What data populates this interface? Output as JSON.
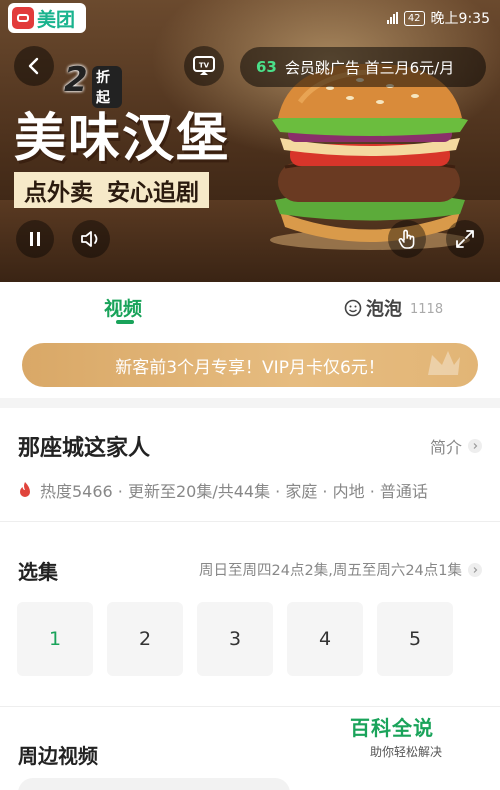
{
  "status_bar": {
    "time": "晚上9:35",
    "battery": "42"
  },
  "app_badge": {
    "name": "美团"
  },
  "ad": {
    "skip_count": "63",
    "skip_text": "会员跳广告 首三月6元/月",
    "promo_number": "2",
    "promo_text": "折起",
    "headline": "美味汉堡",
    "sub_left": "点外卖",
    "sub_right": "安心追剧"
  },
  "tabs": {
    "video": "视频",
    "bubbles": "泡泡",
    "bubbles_count": "1118"
  },
  "vip_banner": {
    "text": "新客前3个月专享！VIP月卡仅6元！"
  },
  "show": {
    "title": "那座城这家人",
    "intro_link": "简介",
    "meta": "热度5466 · 更新至20集/共44集 · 家庭 · 内地 · 普通话"
  },
  "episodes": {
    "title": "选集",
    "schedule": "周日至周四24点2集,周五至周六24点1集",
    "items": [
      "1",
      "2",
      "3",
      "4",
      "5"
    ]
  },
  "nearby": {
    "title": "周边视频"
  },
  "watermark": {
    "big": "百科全说",
    "small": "助你轻松解决"
  },
  "colors": {
    "accent_green": "#19a35a",
    "vip_gold": "#d9a867"
  }
}
